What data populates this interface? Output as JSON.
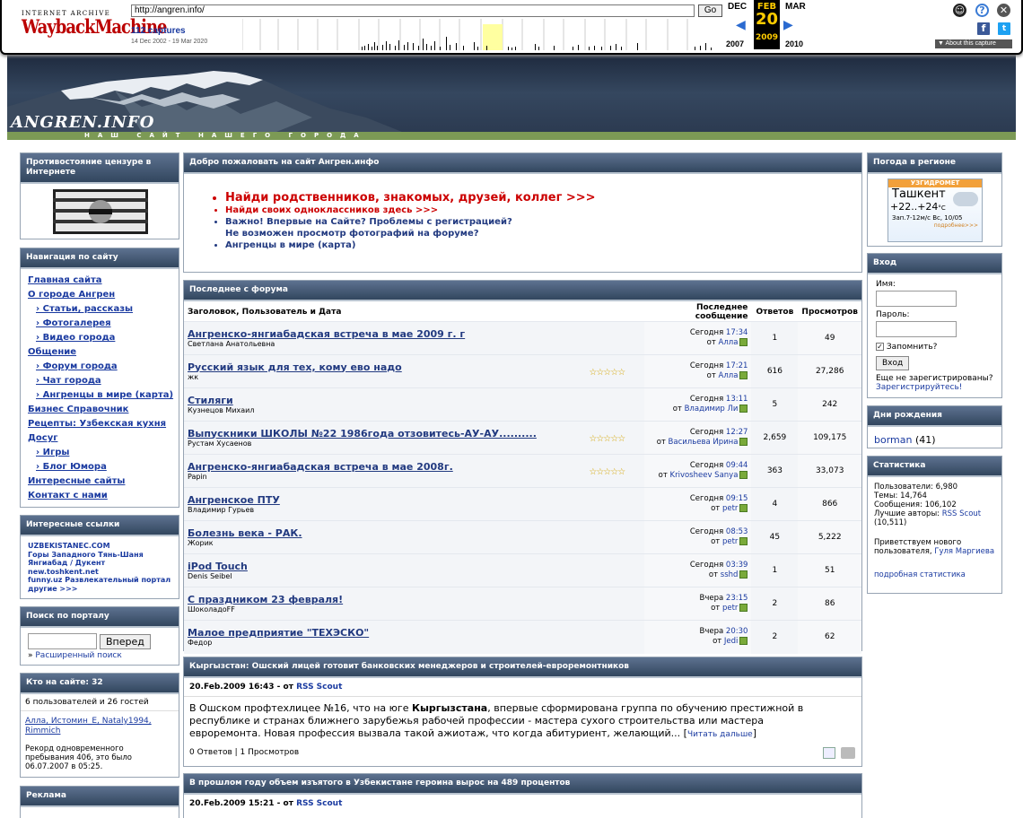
{
  "wayback": {
    "logo_top": "INTERNET ARCHIVE",
    "logo_main": "WaybackMachine",
    "url": "http://angren.info/",
    "go": "Go",
    "captures": "112 captures",
    "range": "14 Dec 2002 - 19 Mar 2020",
    "prev_month": "DEC",
    "cur_month": "FEB",
    "next_month": "MAR",
    "cur_day": "20",
    "prev_year": "2007",
    "cur_year": "2009",
    "next_year": "2010",
    "about": "▼ About this capture"
  },
  "banner": {
    "logo": "ANGREN.INFO",
    "tagline": "НАШ САЙТ НАШЕГО ГОРОДА"
  },
  "left": {
    "censorship_title": "Противостояние цензуре в Интернете",
    "nav_title": "Навигация по сайту",
    "nav": [
      {
        "label": "Главная сайта",
        "sub": false
      },
      {
        "label": "О городе Ангрен",
        "sub": false
      },
      {
        "label": "› Статьи, рассказы",
        "sub": true
      },
      {
        "label": "› Фотогалерея",
        "sub": true
      },
      {
        "label": "› Видео города",
        "sub": true
      },
      {
        "label": "Общение",
        "sub": false
      },
      {
        "label": "› Форум города",
        "sub": true
      },
      {
        "label": "› Чат города",
        "sub": true
      },
      {
        "label": "› Ангренцы в мире (карта)",
        "sub": true
      },
      {
        "label": "Бизнес Справочник",
        "sub": false
      },
      {
        "label": "Рецепты: Узбекская кухня",
        "sub": false
      },
      {
        "label": "Досуг",
        "sub": false
      },
      {
        "label": "› Игры",
        "sub": true
      },
      {
        "label": "› Блог Юмора",
        "sub": true
      },
      {
        "label": "Интересные сайты",
        "sub": false
      },
      {
        "label": "Контакт с нами",
        "sub": false
      }
    ],
    "links_title": "Интересные ссылки",
    "links": [
      "UZBEKISTANEC.COM",
      "Горы Западного Тянь-Шаня",
      "Янгиабад / Дукент",
      "new.toshkent.net",
      "funny.uz Развлекательный портал",
      "другие >>>"
    ],
    "search_title": "Поиск по порталу",
    "search_button": "Вперед",
    "search_adv": "Расширенный поиск",
    "online_title": "Кто на сайте: 32",
    "online_count": "6 пользователей и 26 гостей",
    "online_users": "Алла, Истомин_Е, Nataly1994, Rimmich",
    "record": "Рекорд одновременного пребывания 406, это было 06.07.2007 в 05:25.",
    "ads_title": "Реклама"
  },
  "welcome": {
    "title": "Добро пожаловать на сайт Ангрен.инфо",
    "links": [
      "Найди родственников, знакомых, друзей, коллег >>>",
      "Найди своих одноклассников здесь >>>",
      "Важно! Впервые на Сайте? Проблемы с регистрацией?",
      "Не возможен просмотр фотографий на форуме?",
      "Ангренцы в мире (карта)"
    ]
  },
  "forum": {
    "title": "Последнее с форума",
    "cols": [
      "Заголовок, Пользователь и Дата",
      "Последнее сообщение",
      "Ответов",
      "Просмотров"
    ],
    "rows": [
      {
        "title": "Ангренско-янгиабадская встреча в мае 2009 г. г",
        "author": "Светлана Анатольевна",
        "stars": "",
        "when": "Сегодня",
        "time": "17:34",
        "by": "Алла",
        "replies": "1",
        "views": "49"
      },
      {
        "title": "Русский язык для тех, кому ево надо",
        "author": "жк",
        "stars": "☆☆☆☆☆",
        "when": "Сегодня",
        "time": "17:21",
        "by": "Алла",
        "replies": "616",
        "views": "27,286"
      },
      {
        "title": "Стиляги",
        "author": "Кузнецов Михаил",
        "stars": "",
        "when": "Сегодня",
        "time": "13:11",
        "by": "Владимир Ли",
        "replies": "5",
        "views": "242"
      },
      {
        "title": "Выпускники ШКОЛЫ №22 1986года отзовитесь-АУ-АУ..........",
        "author": "Рустам Хусаенов",
        "stars": "☆☆☆☆☆",
        "when": "Сегодня",
        "time": "12:27",
        "by": "Васильева Ирина",
        "replies": "2,659",
        "views": "109,175"
      },
      {
        "title": "Ангренско-янгиабадская встреча в мае 2008г.",
        "author": "Papin",
        "stars": "☆☆☆☆☆",
        "when": "Сегодня",
        "time": "09:44",
        "by": "Krivosheev Sanya",
        "replies": "363",
        "views": "33,073"
      },
      {
        "title": "Ангренское ПТУ",
        "author": "Владимир Гурьев",
        "stars": "",
        "when": "Сегодня",
        "time": "09:15",
        "by": "petr",
        "replies": "4",
        "views": "866"
      },
      {
        "title": "Болезнь века - РАК.",
        "author": "Жорик",
        "stars": "",
        "when": "Сегодня",
        "time": "08:53",
        "by": "petr",
        "replies": "45",
        "views": "5,222"
      },
      {
        "title": "iPod Touch",
        "author": "Denis Seibel",
        "stars": "",
        "when": "Сегодня",
        "time": "03:39",
        "by": "sshd",
        "replies": "1",
        "views": "51"
      },
      {
        "title": "С праздником 23 февраля!",
        "author": "ШоколадоFF",
        "stars": "",
        "when": "Вчера",
        "time": "23:15",
        "by": "petr",
        "replies": "2",
        "views": "86"
      },
      {
        "title": "Малое предприятие \"ТЕХЭСКО\"",
        "author": "Федор",
        "stars": "",
        "when": "Вчера",
        "time": "20:30",
        "by": "Jedi",
        "replies": "2",
        "views": "62"
      }
    ]
  },
  "news1": {
    "title": "Кыргызстан: Ошский лицей готовит банковских менеджеров и строителей-евроремонтников",
    "meta": "20.Feb.2009 16:43 - от ",
    "author": "RSS Scout",
    "body_a": "В Ошском профтехлицее №16, что на юге ",
    "body_b": "Кыргызстана",
    "body_c": ", впервые сформирована группа по обучению престижной в республике и странах ближнего зарубежья рабочей профессии - мастера сухого строительства или мастера евроремонта. Новая профессия вызвала такой ажиотаж, что когда абитуриент, желающий... [",
    "more": "Читать дальше",
    "close": "]",
    "footer": "0 Ответов | 1 Просмотров"
  },
  "news2": {
    "title": "В прошлом году объем изъятого в Узбекистане героина вырос на 489 процентов",
    "meta": "20.Feb.2009 15:21 - от ",
    "author": "RSS Scout"
  },
  "right": {
    "weather_title": "Погода в регионе",
    "weather_brand": "УЗГИДРОМЕТ",
    "weather_city": "Ташкент",
    "weather_temp": "+22..+24",
    "weather_unit": "°C",
    "weather_wind": "Зап.7-12м/с",
    "weather_date": "Вс, 10/05",
    "weather_more": "подробнее>>>",
    "login_title": "Вход",
    "name_label": "Имя:",
    "pass_label": "Пароль:",
    "remember": "Запомнить?",
    "login_btn": "Вход",
    "not_reg": "Еще не зарегистрированы?",
    "register": "Зарегистрируйтесь!",
    "bday_title": "Дни рождения",
    "bday_user": "borman",
    "bday_age": "(41)",
    "stats_title": "Статистика",
    "stats_users": "Пользователи: 6,980",
    "stats_topics": "Темы: 14,764",
    "stats_posts": "Сообщения: 106,102",
    "stats_best": "Лучшие авторы: ",
    "stats_best_user": "RSS Scout",
    "stats_best_count": "(10,511)",
    "welcome_new": "Приветствуем нового пользователя, ",
    "new_user": "Гуля Маргиева",
    "more_stats": "подробная статистика"
  }
}
